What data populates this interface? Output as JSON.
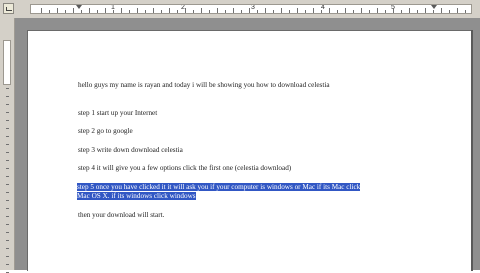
{
  "ruler": {
    "numbers": [
      "1",
      "2",
      "3",
      "4",
      "5"
    ]
  },
  "document": {
    "paragraphs": [
      "hello guys my name is rayan and today i will be showing you how to download celestia",
      "step 1 start up your Internet",
      "step 2 go to google",
      "step 3 write down download celestia",
      "step 4 it will give you a few options click the first one (celestia download)"
    ],
    "selected_line_1": "step 5 once you have clicked it it will ask you if your computer is windows or Mac if its Mac click",
    "selected_line_2": "Mac OS X. if its windows click windows",
    "final_paragraph": "then your download will start."
  },
  "colors": {
    "selection": "#3157c4",
    "desk": "#8f8f8f",
    "toolbar": "#d4d0c8"
  }
}
